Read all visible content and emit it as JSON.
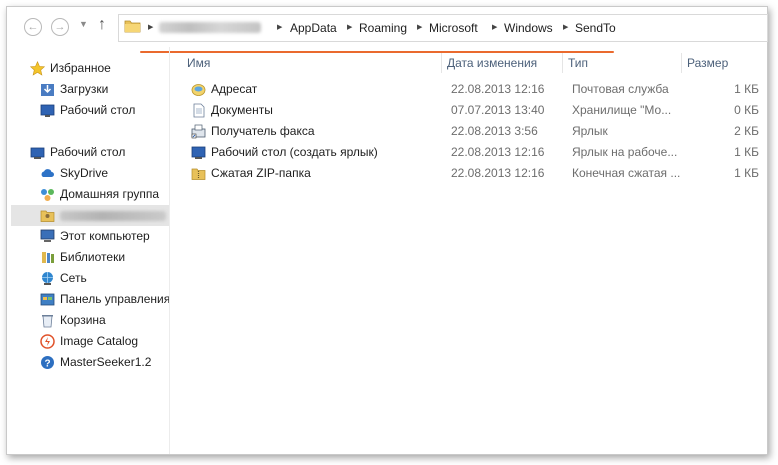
{
  "address_bar": {
    "crumbs": [
      "AppData",
      "Roaming",
      "Microsoft",
      "Windows",
      "SendTo"
    ]
  },
  "sidebar": {
    "favorites_header": "Избранное",
    "favorites": [
      {
        "label": "Загрузки",
        "icon": "downloads-icon"
      },
      {
        "label": "Рабочий стол",
        "icon": "desktop-icon"
      }
    ],
    "desktop_header": "Рабочий стол",
    "desktop_items": [
      {
        "label": "SkyDrive",
        "icon": "skydrive-icon"
      },
      {
        "label": "Домашняя группа",
        "icon": "homegroup-icon"
      },
      {
        "label": "",
        "icon": "user-folder-icon"
      },
      {
        "label": "Этот компьютер",
        "icon": "computer-icon"
      },
      {
        "label": "Библиотеки",
        "icon": "libraries-icon"
      },
      {
        "label": "Сеть",
        "icon": "network-icon"
      },
      {
        "label": "Панель управления",
        "icon": "control-panel-icon"
      },
      {
        "label": "Корзина",
        "icon": "recycle-bin-icon"
      },
      {
        "label": "Image Catalog",
        "icon": "image-catalog-icon"
      },
      {
        "label": "MasterSeeker1.2",
        "icon": "help-icon"
      }
    ]
  },
  "columns": {
    "name": "Имя",
    "date": "Дата изменения",
    "type": "Тип",
    "size": "Размер"
  },
  "files": [
    {
      "name": "Адресат",
      "date": "22.08.2013 12:16",
      "type": "Почтовая служба",
      "size": "1 КБ",
      "icon": "mail-recipient-icon"
    },
    {
      "name": "Документы",
      "date": "07.07.2013 13:40",
      "type": "Хранилище \"Мо...",
      "size": "0 КБ",
      "icon": "documents-icon"
    },
    {
      "name": "Получатель факса",
      "date": "22.08.2013 3:56",
      "type": "Ярлык",
      "size": "2 КБ",
      "icon": "fax-icon"
    },
    {
      "name": "Рабочий стол (создать ярлык)",
      "date": "22.08.2013 12:16",
      "type": "Ярлык на рабоче...",
      "size": "1 КБ",
      "icon": "desktop-icon"
    },
    {
      "name": "Сжатая ZIP-папка",
      "date": "22.08.2013 12:16",
      "type": "Конечная сжатая ...",
      "size": "1 КБ",
      "icon": "zip-folder-icon"
    }
  ],
  "colors": {
    "accent_underline": "#ea6a2e",
    "column_header_text": "#4c607a",
    "selected_row": "#e5e5e5"
  }
}
